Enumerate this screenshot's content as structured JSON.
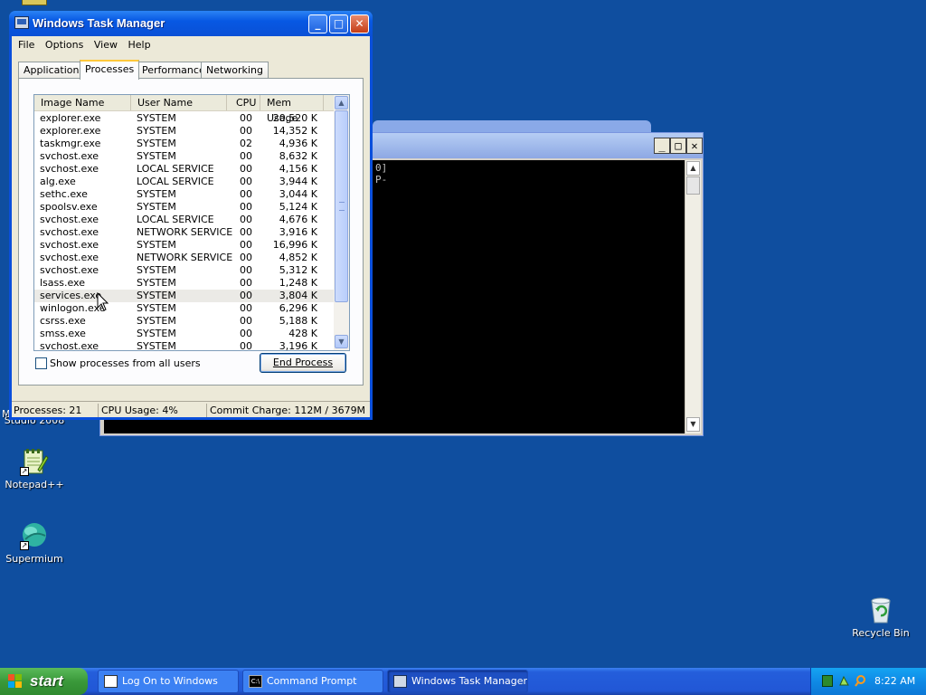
{
  "desktop": {
    "icons": [
      {
        "label": "Studio 2008",
        "name": "visual-studio-icon"
      },
      {
        "label": "Notepad++",
        "name": "notepad-plus-plus-icon"
      },
      {
        "label": "Supermium",
        "name": "supermium-icon"
      },
      {
        "label": "Recycle Bin",
        "name": "recycle-bin-icon"
      }
    ],
    "partial_label": "M",
    "background_color": "#0f4e9f"
  },
  "command_prompt": {
    "console_lines": [
      "0]",
      "P-"
    ],
    "buttons": {
      "minimize": "_",
      "maximize": "□",
      "close": "✕"
    }
  },
  "task_manager": {
    "title": "Windows Task Manager",
    "title_buttons": {
      "minimize": "_",
      "maximize": "□",
      "close": "✕"
    },
    "menu": [
      "File",
      "Options",
      "View",
      "Help"
    ],
    "tabs": [
      {
        "label": "Applications",
        "active": false
      },
      {
        "label": "Processes",
        "active": true
      },
      {
        "label": "Performance",
        "active": false
      },
      {
        "label": "Networking",
        "active": false
      }
    ],
    "columns": [
      "Image Name",
      "User Name",
      "CPU",
      "Mem Usage"
    ],
    "processes": [
      {
        "image": "explorer.exe",
        "user": "SYSTEM",
        "cpu": "00",
        "mem": "20,520 K"
      },
      {
        "image": "explorer.exe",
        "user": "SYSTEM",
        "cpu": "00",
        "mem": "14,352 K"
      },
      {
        "image": "taskmgr.exe",
        "user": "SYSTEM",
        "cpu": "02",
        "mem": "4,936 K"
      },
      {
        "image": "svchost.exe",
        "user": "SYSTEM",
        "cpu": "00",
        "mem": "8,632 K"
      },
      {
        "image": "svchost.exe",
        "user": "LOCAL SERVICE",
        "cpu": "00",
        "mem": "4,156 K"
      },
      {
        "image": "alg.exe",
        "user": "LOCAL SERVICE",
        "cpu": "00",
        "mem": "3,944 K"
      },
      {
        "image": "sethc.exe",
        "user": "SYSTEM",
        "cpu": "00",
        "mem": "3,044 K"
      },
      {
        "image": "spoolsv.exe",
        "user": "SYSTEM",
        "cpu": "00",
        "mem": "5,124 K"
      },
      {
        "image": "svchost.exe",
        "user": "LOCAL SERVICE",
        "cpu": "00",
        "mem": "4,676 K"
      },
      {
        "image": "svchost.exe",
        "user": "NETWORK SERVICE",
        "cpu": "00",
        "mem": "3,916 K"
      },
      {
        "image": "svchost.exe",
        "user": "SYSTEM",
        "cpu": "00",
        "mem": "16,996 K"
      },
      {
        "image": "svchost.exe",
        "user": "NETWORK SERVICE",
        "cpu": "00",
        "mem": "4,852 K"
      },
      {
        "image": "svchost.exe",
        "user": "SYSTEM",
        "cpu": "00",
        "mem": "5,312 K"
      },
      {
        "image": "lsass.exe",
        "user": "SYSTEM",
        "cpu": "00",
        "mem": "1,248 K"
      },
      {
        "image": "services.exe",
        "user": "SYSTEM",
        "cpu": "00",
        "mem": "3,804 K",
        "selected": true
      },
      {
        "image": "winlogon.exe",
        "user": "SYSTEM",
        "cpu": "00",
        "mem": "6,296 K"
      },
      {
        "image": "csrss.exe",
        "user": "SYSTEM",
        "cpu": "00",
        "mem": "5,188 K"
      },
      {
        "image": "smss.exe",
        "user": "SYSTEM",
        "cpu": "00",
        "mem": "428 K"
      },
      {
        "image": "svchost.exe",
        "user": "SYSTEM",
        "cpu": "00",
        "mem": "3,196 K"
      }
    ],
    "show_all_label": "Show processes from all users",
    "end_process_label": "End Process",
    "status": {
      "processes": "Processes: 21",
      "cpu": "CPU Usage: 4%",
      "commit": "Commit Charge: 112M / 3679M"
    }
  },
  "taskbar": {
    "start_label": "start",
    "tasks": [
      {
        "label": "Log On to Windows",
        "active": false
      },
      {
        "label": "Command Prompt",
        "active": false
      },
      {
        "label": "Windows Task Manager",
        "active": true
      }
    ],
    "clock": "8:22 AM"
  }
}
